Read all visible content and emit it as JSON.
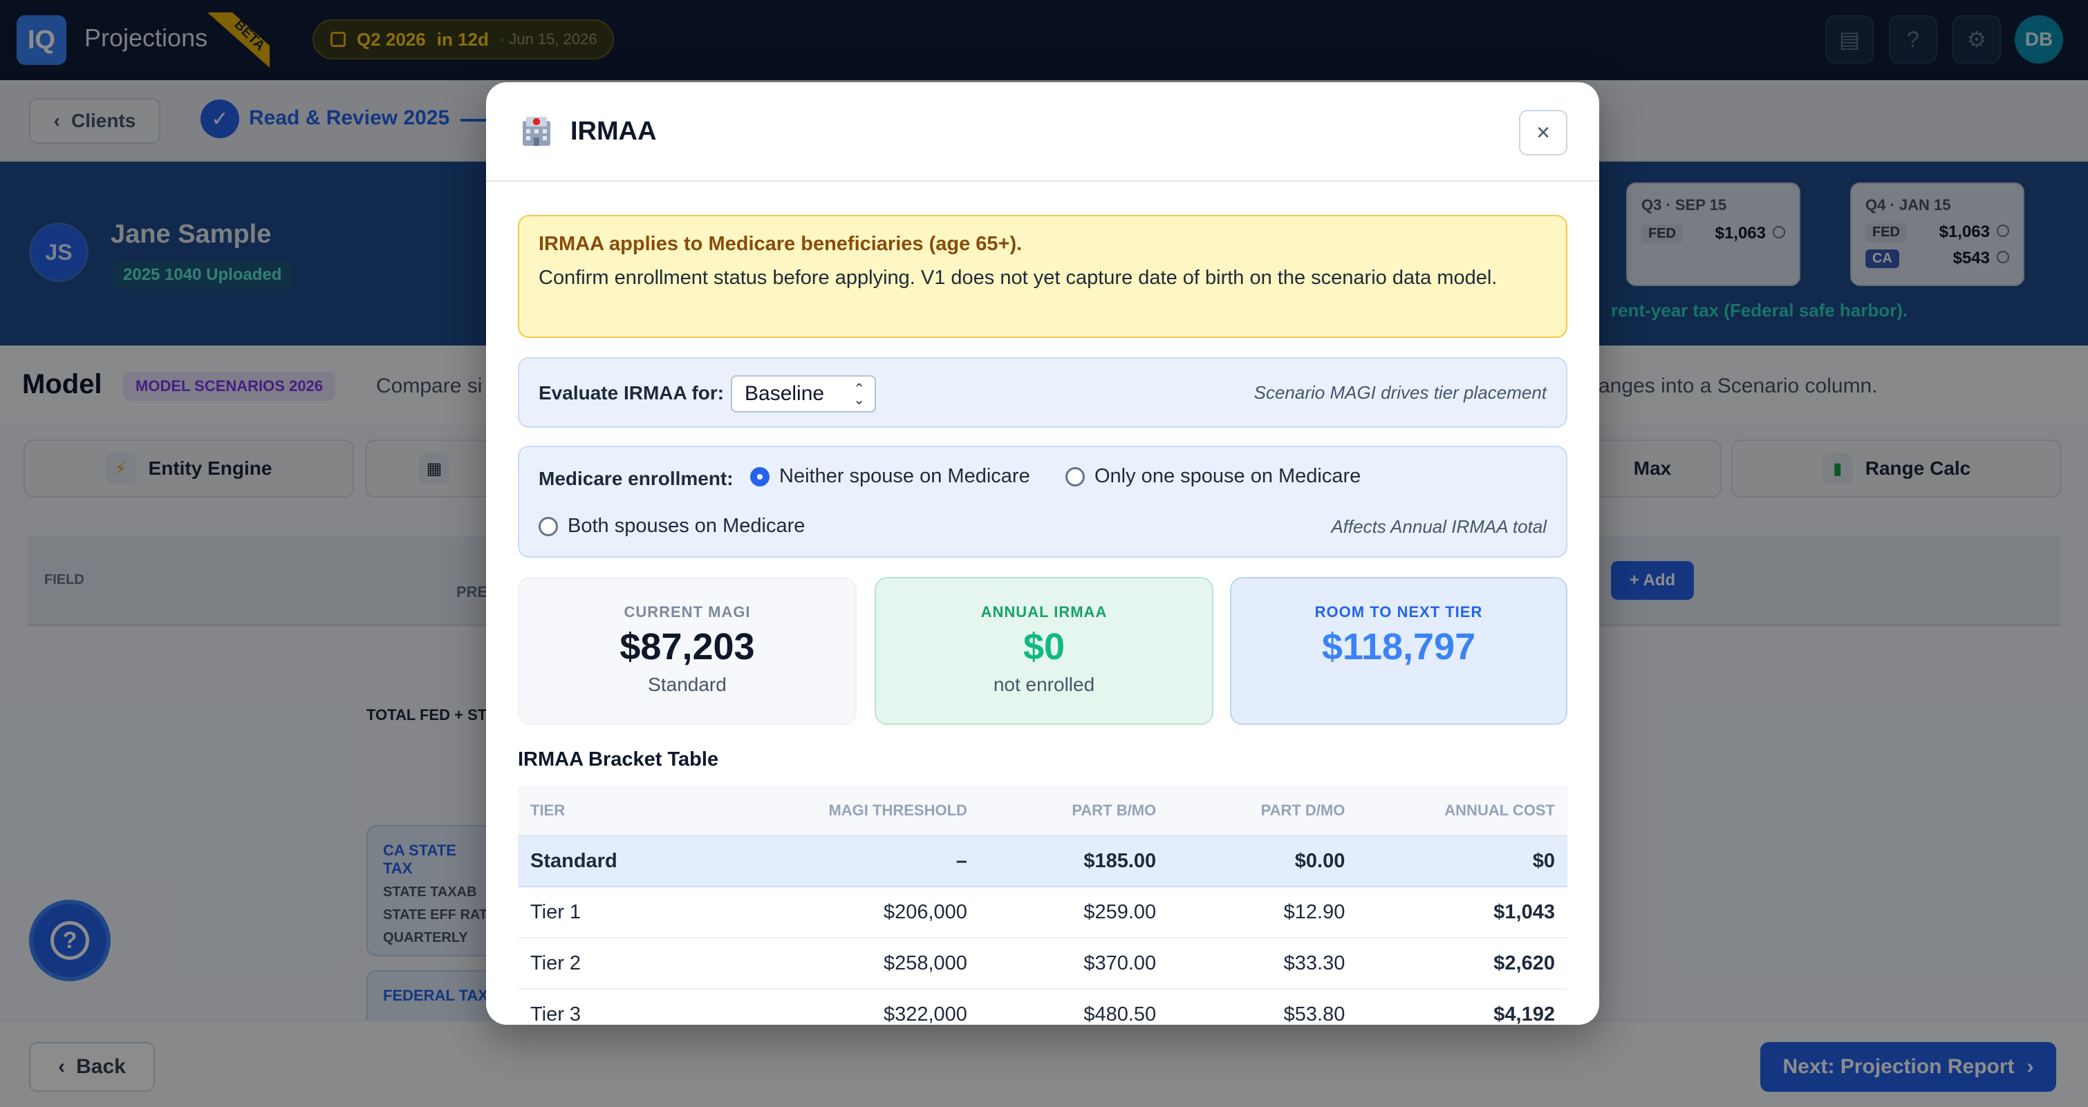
{
  "app": {
    "logo_text": "IQ",
    "title": "Projections",
    "beta": "BETA",
    "quarter": "Q2 2026",
    "due_in": "in 12d",
    "due_date": "· Jun 15, 2026",
    "user_initials": "DB"
  },
  "steps": {
    "clients_label": "Clients",
    "current_step": "Read & Review 2025"
  },
  "client": {
    "initials": "JS",
    "name": "Jane Sample",
    "badge": "2025 1040 Uploaded",
    "safe_harbor_note": "rent-year tax (Federal safe harbor).",
    "q3": {
      "title": "Q3 · SEP 15",
      "fed_label": "FED",
      "fed_amount": "$1,063"
    },
    "q4": {
      "title": "Q4 · JAN 15",
      "fed_label": "FED",
      "fed_amount": "$1,063",
      "ca_label": "CA",
      "ca_amount": "$543"
    }
  },
  "model": {
    "title": "Model",
    "badge": "MODEL SCENARIOS 2026",
    "desc_left": "Compare si",
    "desc_right": "anges into a Scenario column."
  },
  "tools": {
    "entity_engine": "Entity Engine",
    "max": "Max",
    "range_calc": "Range Calc"
  },
  "grid": {
    "field_header": "FIELD",
    "prior_header": "PRE",
    "add_label": "+ Add",
    "total_label": "TOTAL FED + STA",
    "ca_state_tax": "CA STATE TAX",
    "state_taxable": "STATE TAXAB",
    "state_eff_rate": "STATE EFF RAT",
    "quarterly": "QUARTERLY",
    "federal_tax": "FEDERAL TAX"
  },
  "footer": {
    "back_label": "Back",
    "next_label": "Next: Projection Report"
  },
  "modal": {
    "title": "IRMAA",
    "close_symbol": "×",
    "warning_heading": "IRMAA applies to Medicare beneficiaries (age 65+).",
    "warning_text": "Confirm enrollment status before applying. V1 does not yet capture date of birth on the scenario data model.",
    "evaluate_label": "Evaluate IRMAA for:",
    "evaluate_value": "Baseline",
    "evaluate_note": "Scenario MAGI drives tier placement",
    "enrollment_label": "Medicare enrollment:",
    "enrollment_options": [
      "Neither spouse on Medicare",
      "Only one spouse on Medicare",
      "Both spouses on Medicare"
    ],
    "enrollment_selected": "Neither spouse on Medicare",
    "enrollment_note": "Affects Annual IRMAA total",
    "stats": {
      "current_magi_label": "CURRENT MAGI",
      "current_magi_value": "$87,203",
      "current_magi_sub": "Standard",
      "annual_irmaa_label": "ANNUAL IRMAA",
      "annual_irmaa_value": "$0",
      "annual_irmaa_sub": "not enrolled",
      "room_label": "ROOM TO NEXT TIER",
      "room_value": "$118,797"
    },
    "table_title": "IRMAA Bracket Table",
    "table_headers": [
      "TIER",
      "MAGI THRESHOLD",
      "PART B/MO",
      "PART D/MO",
      "ANNUAL COST"
    ],
    "table_rows": [
      [
        "Standard",
        "–",
        "$185.00",
        "$0.00",
        "$0"
      ],
      [
        "Tier 1",
        "$206,000",
        "$259.00",
        "$12.90",
        "$1,043"
      ],
      [
        "Tier 2",
        "$258,000",
        "$370.00",
        "$33.30",
        "$2,620"
      ],
      [
        "Tier 3",
        "$322,000",
        "$480.50",
        "$53.80",
        "$4,192"
      ]
    ]
  },
  "colors": {
    "accent": "#2563eb",
    "warning_bg": "#fef7c3",
    "success": "#10b981"
  }
}
